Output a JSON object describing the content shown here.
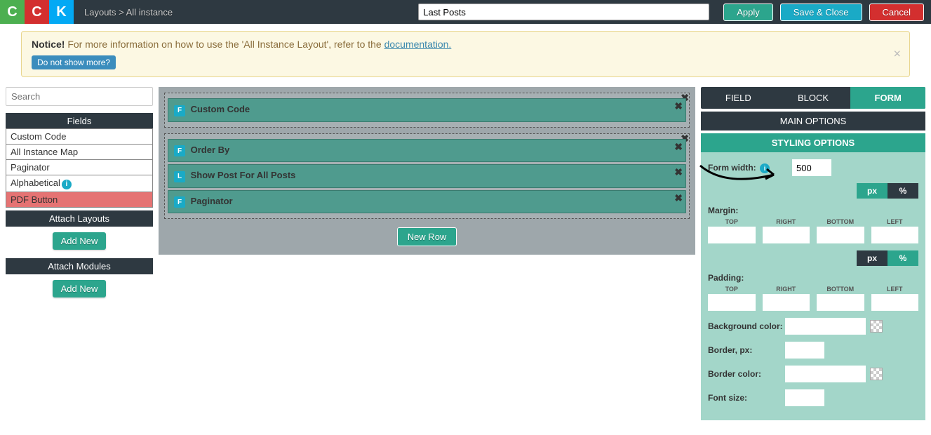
{
  "logo": {
    "c1": "C",
    "c2": "C",
    "c3": "K"
  },
  "breadcrumb": "Layouts > All instance",
  "title_input": "Last Posts",
  "buttons": {
    "apply": "Apply",
    "save": "Save & Close",
    "cancel": "Cancel"
  },
  "notice": {
    "strong": "Notice!",
    "text": " For more information on how to use the 'All Instance Layout', refer to the ",
    "link": "documentation.",
    "btn": "Do not show more?"
  },
  "search_placeholder": "Search",
  "sections": {
    "fields": "Fields",
    "attach_layouts": "Attach Layouts",
    "attach_modules": "Attach Modules",
    "add_new": "Add New"
  },
  "field_items": [
    "Custom Code",
    "All Instance Map",
    "Paginator",
    "Alphabetical",
    "PDF Button"
  ],
  "canvas_rows": [
    {
      "blocks": [
        {
          "badge": "F",
          "text": "Custom Code"
        }
      ]
    },
    {
      "blocks": [
        {
          "badge": "F",
          "text": "Order By"
        },
        {
          "badge": "L",
          "text": "Show Post For All Posts"
        },
        {
          "badge": "F",
          "text": "Paginator"
        }
      ]
    }
  ],
  "new_row": "New Row",
  "tabs": {
    "field": "FIELD",
    "block": "BLOCK",
    "form": "FORM"
  },
  "subheaders": {
    "main": "MAIN OPTIONS",
    "styling": "STYLING OPTIONS"
  },
  "styling": {
    "form_width_label": "Form width:",
    "form_width_value": "500",
    "margin_label": "Margin:",
    "padding_label": "Padding:",
    "px": "px",
    "pct": "%",
    "top": "TOP",
    "right": "RIGHT",
    "bottom": "BOTTOM",
    "left": "LEFT",
    "bg_label": "Background color:",
    "border_label": "Border, px:",
    "border_color_label": "Border color:",
    "font_size_label": "Font size:"
  }
}
